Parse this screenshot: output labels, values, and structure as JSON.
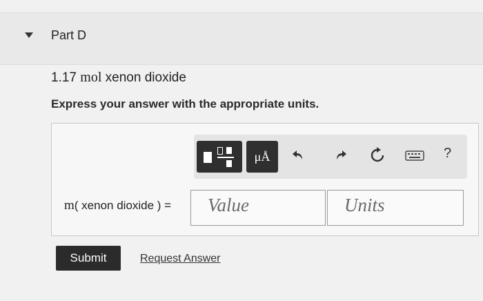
{
  "part": {
    "title": "Part D"
  },
  "question": {
    "amount": "1.17",
    "unit": "mol",
    "substance": "xenon dioxide",
    "instruction": "Express your answer with the appropriate units."
  },
  "toolbar": {
    "units_label": "μÅ",
    "help_label": "?",
    "icons": [
      "templates-icon",
      "units-icon",
      "undo-icon",
      "redo-icon",
      "reset-icon",
      "keyboard-icon",
      "help-icon"
    ]
  },
  "answer": {
    "m_label": "m",
    "lhs_text": "( xenon dioxide ) =",
    "value_placeholder": "Value",
    "units_placeholder": "Units"
  },
  "actions": {
    "submit_label": "Submit",
    "request_label": "Request Answer"
  }
}
